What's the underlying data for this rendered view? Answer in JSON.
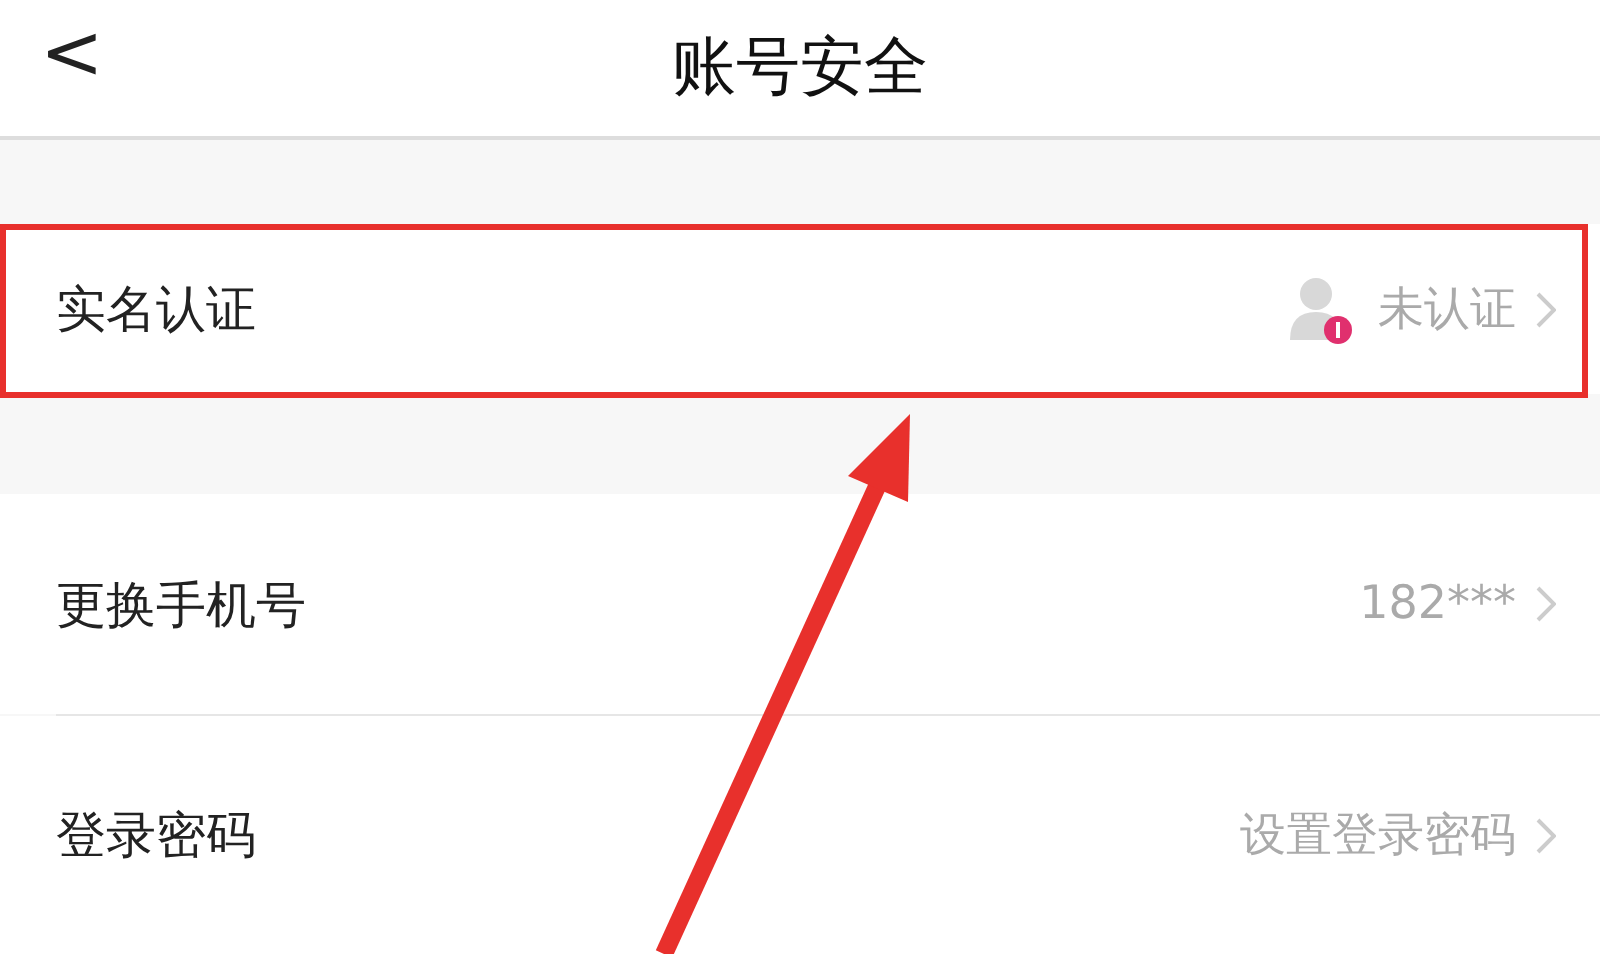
{
  "header": {
    "back": "<",
    "title": "账号安全"
  },
  "rows": [
    {
      "kind": "identity",
      "label": "实名认证",
      "value": "未认证",
      "highlighted": true
    },
    {
      "kind": "text",
      "label": "更换手机号",
      "value": "182***"
    },
    {
      "kind": "text",
      "label": "登录密码",
      "value": "设置登录密码"
    }
  ]
}
